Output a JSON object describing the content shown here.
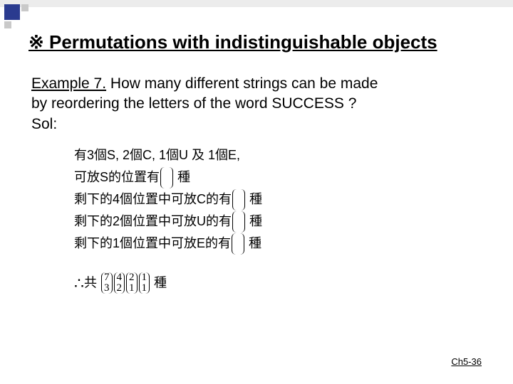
{
  "title": "※ Permutations with indistinguishable objects",
  "example": {
    "label": "Example 7.",
    "question_line1": "How many different strings can be made",
    "question_line2": "by reordering the letters of the word SUCCESS ?",
    "sol_label": "Sol:"
  },
  "lines": {
    "l1": "有3個S, 2個C, 1個U 及 1個E,",
    "l2_pre": "可放S的位置有",
    "l2_post": " 種",
    "l3_pre": "剩下的4個位置中可放C的有",
    "l3_post": " 種",
    "l4_pre": "剩下的2個位置中可放U的有",
    "l4_post": " 種",
    "l5_pre": "剩下的1個位置中可放E的有",
    "l5_post": " 種",
    "final_pre": "共 ",
    "final_post": " 種"
  },
  "binoms": {
    "b1": {
      "n": "7",
      "k": "3"
    },
    "b2": {
      "n": "4",
      "k": "2"
    },
    "b3": {
      "n": "2",
      "k": "1"
    },
    "b4": {
      "n": "1",
      "k": "1"
    }
  },
  "footer": "Ch5-36"
}
